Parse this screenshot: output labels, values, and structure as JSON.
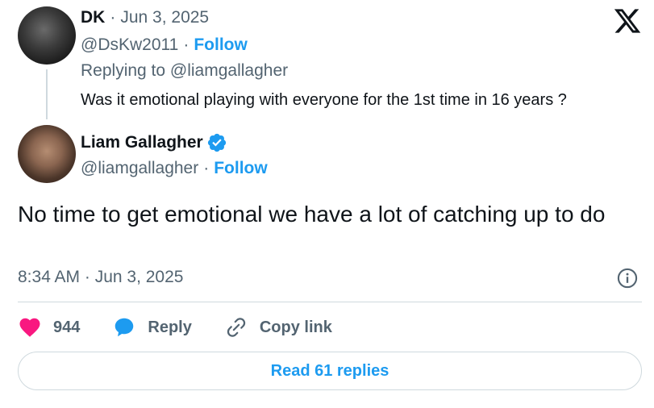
{
  "parent_tweet": {
    "display_name": "DK",
    "separator": "·",
    "date": "Jun 3, 2025",
    "handle": "@DsKw2011",
    "follow_label": "Follow",
    "replying_to": "Replying to @liamgallagher",
    "text": "Was it emotional playing with everyone for the 1st time in 16 years ?"
  },
  "main_tweet": {
    "display_name": "Liam Gallagher",
    "verified": true,
    "handle": "@liamgallagher",
    "separator": "·",
    "follow_label": "Follow",
    "text": "No time to get emotional we have a lot of catching up to do",
    "timestamp": "8:34 AM · Jun 3, 2025"
  },
  "actions": {
    "like_count": "944",
    "reply_label": "Reply",
    "copy_link_label": "Copy link"
  },
  "footer": {
    "read_replies_label": "Read 61 replies"
  },
  "icons": {
    "logo": "x-logo-icon",
    "verified": "verified-badge-icon",
    "info": "info-icon",
    "like": "heart-icon",
    "reply": "reply-bubble-icon",
    "copy": "link-icon"
  },
  "colors": {
    "accent": "#1d9bf0",
    "like": "#f91880",
    "text": "#0f1419",
    "muted": "#536471",
    "border": "#cfd9de"
  }
}
